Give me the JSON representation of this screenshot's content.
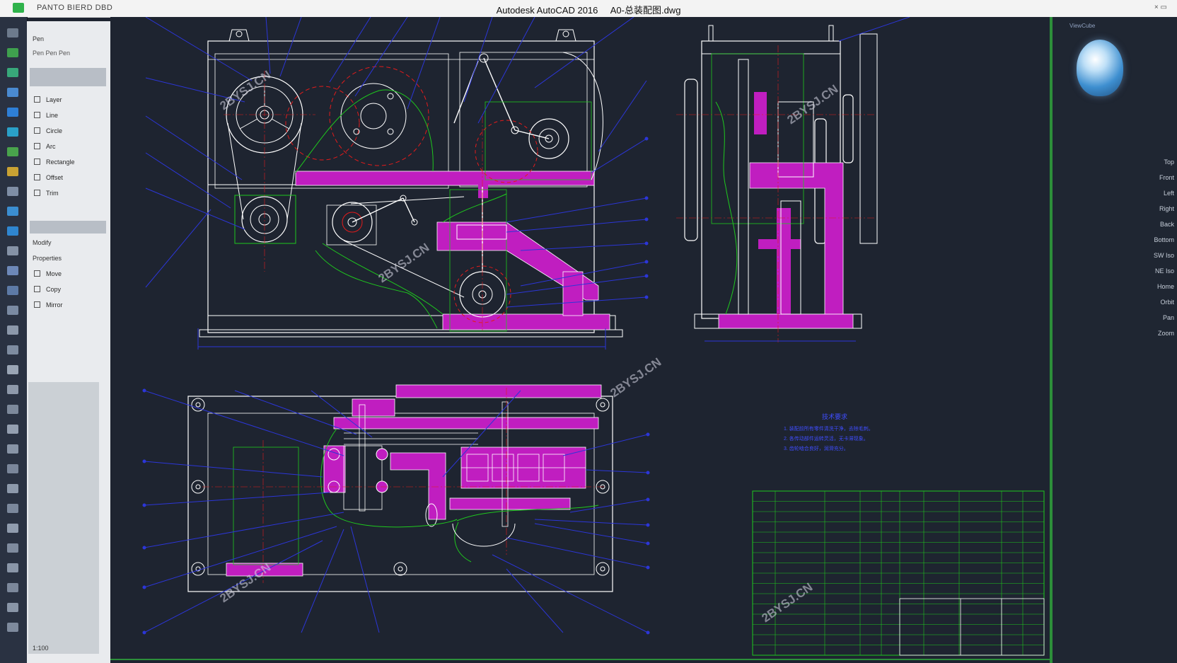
{
  "titlebar": {
    "app_title": "Autodesk AutoCAD 2016",
    "file_name": "A0-总装配图.dwg",
    "left_label": "PANTO BIERD DBD",
    "window_controls": "× ▭"
  },
  "palette": {
    "header": "Pen",
    "subheader": "Pen  Pen  Pen",
    "items": [
      "Layer",
      "Line",
      "Circle",
      "Arc",
      "Rectangle",
      "Offset",
      "Trim"
    ],
    "group2_label": "Modify",
    "group2_sub": "Properties",
    "items2": [
      "Move",
      "Copy",
      "Mirror"
    ],
    "footer": "1:100"
  },
  "right_panel": {
    "viewcube_label": "ViewCube",
    "items": [
      "Top",
      "Front",
      "Left",
      "Right",
      "Back",
      "Bottom",
      "SW Iso",
      "NE Iso",
      "Home",
      "Orbit",
      "Pan",
      "Zoom"
    ]
  },
  "drawing": {
    "watermark": "2BYSJ.CN",
    "notes_title": "技术要求",
    "notes": [
      "1. 装配前所有零件清洗干净，去除毛刺。",
      "2. 各传动部件运转灵活，无卡滞现象。",
      "3. 齿轮啮合良好，润滑充分。"
    ]
  },
  "colors": {
    "bg": "#1e2430",
    "line_white": "#ffffff",
    "line_blue": "#2c36d8",
    "line_red": "#e31b1b",
    "line_green": "#1ec81e",
    "hatch_magenta": "#c01ec0",
    "frame_green": "#2c8f3a"
  }
}
